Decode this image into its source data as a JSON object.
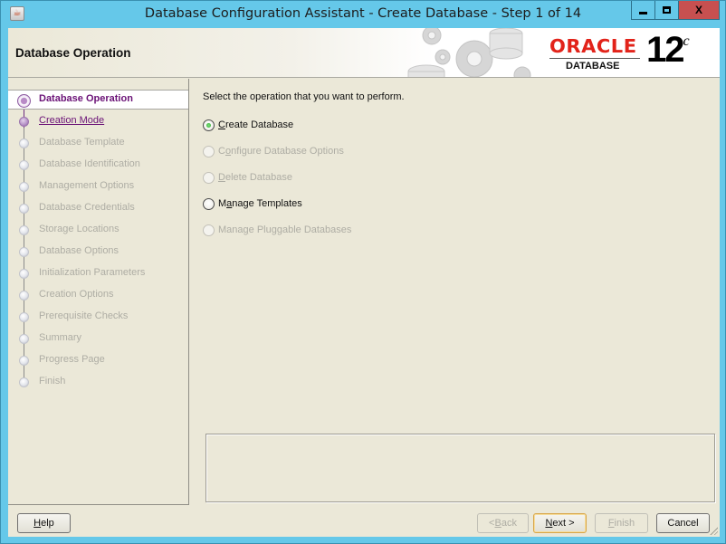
{
  "window": {
    "title": "Database Configuration Assistant - Create Database - Step 1 of 14",
    "app_icon": "java-cup-icon",
    "controls": {
      "minimize": "minimize-icon",
      "maximize": "maximize-icon",
      "close": "X"
    }
  },
  "banner": {
    "title": "Database Operation",
    "logo_brand": "ORACLE",
    "logo_product": "DATABASE",
    "version_number": "12",
    "version_suffix": "c"
  },
  "nav": {
    "items": [
      {
        "label": "Database Operation",
        "state": "current"
      },
      {
        "label": "Creation Mode",
        "state": "next"
      },
      {
        "label": "Database Template",
        "state": "pending"
      },
      {
        "label": "Database Identification",
        "state": "pending"
      },
      {
        "label": "Management Options",
        "state": "pending"
      },
      {
        "label": "Database Credentials",
        "state": "pending"
      },
      {
        "label": "Storage Locations",
        "state": "pending"
      },
      {
        "label": "Database Options",
        "state": "pending"
      },
      {
        "label": "Initialization Parameters",
        "state": "pending"
      },
      {
        "label": "Creation Options",
        "state": "pending"
      },
      {
        "label": "Prerequisite Checks",
        "state": "pending"
      },
      {
        "label": "Summary",
        "state": "pending"
      },
      {
        "label": "Progress Page",
        "state": "pending"
      },
      {
        "label": "Finish",
        "state": "pending"
      }
    ]
  },
  "main": {
    "prompt": "Select the operation that you want to perform.",
    "options": [
      {
        "pre": "",
        "mnemonic": "C",
        "post": "reate Database",
        "selected": true,
        "enabled": true
      },
      {
        "pre": "C",
        "mnemonic": "o",
        "post": "nfigure Database Options",
        "selected": false,
        "enabled": false
      },
      {
        "pre": "",
        "mnemonic": "D",
        "post": "elete Database",
        "selected": false,
        "enabled": false
      },
      {
        "pre": "M",
        "mnemonic": "a",
        "post": "nage Templates",
        "selected": false,
        "enabled": true
      },
      {
        "pre": "Mana",
        "mnemonic": "g",
        "post": "e Pluggable Databases",
        "selected": false,
        "enabled": false
      }
    ],
    "description": ""
  },
  "buttons": {
    "help": {
      "pre": "",
      "mnemonic": "H",
      "post": "elp",
      "enabled": true
    },
    "back": {
      "pre": "< ",
      "mnemonic": "B",
      "post": "ack",
      "enabled": false
    },
    "next": {
      "pre": "",
      "mnemonic": "N",
      "post": "ext >",
      "enabled": true
    },
    "finish": {
      "pre": "",
      "mnemonic": "F",
      "post": "inish",
      "enabled": false
    },
    "cancel": {
      "pre": "Cancel",
      "mnemonic": "",
      "post": "",
      "enabled": true
    }
  },
  "colors": {
    "title_bar": "#65c8e9",
    "panel_bg": "#ebe8d8",
    "current_step": "#6a1176",
    "disabled_text": "#aeada4",
    "oracle_red": "#e2231a",
    "close_button": "#c75050",
    "radio_checked": "#2ea82e"
  }
}
